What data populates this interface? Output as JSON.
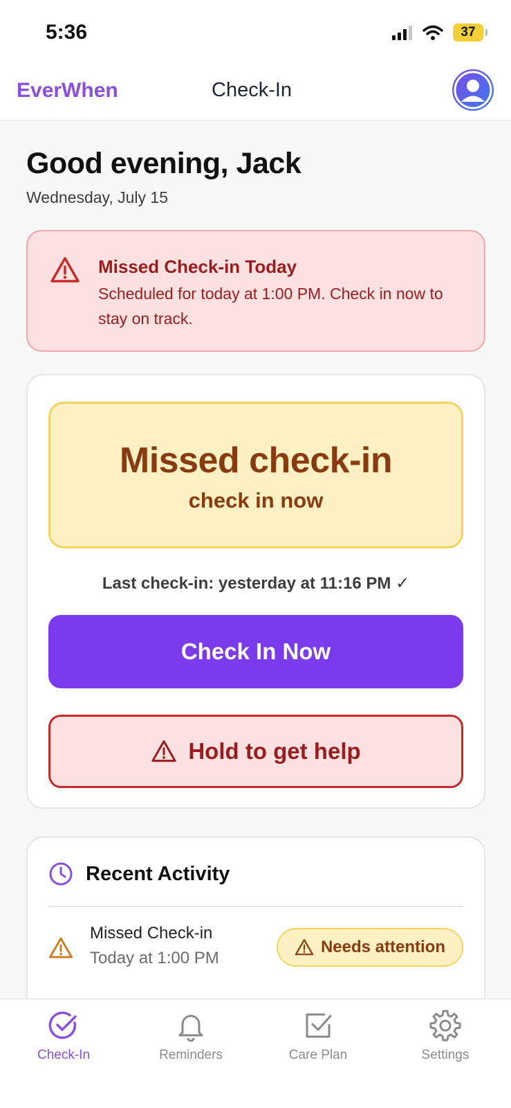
{
  "status_bar": {
    "time": "5:36",
    "battery": "37"
  },
  "header": {
    "brand": "EverWhen",
    "title": "Check-In"
  },
  "greeting": {
    "title": "Good evening, Jack",
    "date": "Wednesday, July 15"
  },
  "alert": {
    "title": "Missed Check-in Today",
    "body": "Scheduled for today at 1:00 PM. Check in now to stay on track."
  },
  "checkin_card": {
    "status_main": "Missed check-in",
    "status_sub": "check in now",
    "last_checkin": "Last check-in: yesterday at 11:16 PM ✓",
    "checkin_button": "Check In Now",
    "help_button": "Hold to get help"
  },
  "activity": {
    "title": "Recent Activity",
    "items": [
      {
        "title": "Missed Check-in",
        "time": "Today at 1:00 PM",
        "badge": "Needs attention"
      }
    ]
  },
  "tabs": [
    {
      "label": "Check-In",
      "icon": "check-circle-icon",
      "active": true
    },
    {
      "label": "Reminders",
      "icon": "bell-icon",
      "active": false
    },
    {
      "label": "Care Plan",
      "icon": "checkbox-icon",
      "active": false
    },
    {
      "label": "Settings",
      "icon": "gear-icon",
      "active": false
    }
  ],
  "colors": {
    "brand": "#8a4ee0",
    "primary_button": "#7c3aed",
    "alert_bg": "#fde1e1",
    "alert_text": "#9b1c1c",
    "warning_bg": "#fdf1c4",
    "warning_text": "#8a3a0f"
  }
}
